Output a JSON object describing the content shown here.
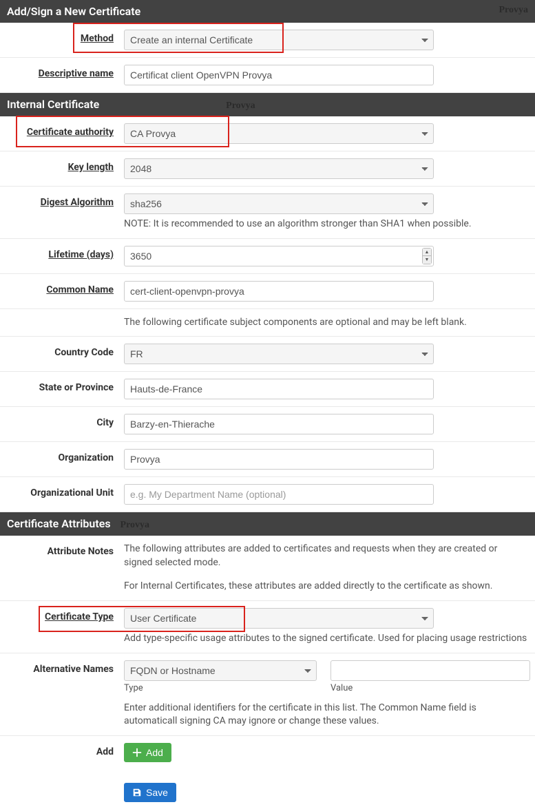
{
  "sections": {
    "add_sign": {
      "title": "Add/Sign a New Certificate",
      "watermark": "Provya"
    },
    "internal": {
      "title": "Internal Certificate",
      "watermark": "Provya"
    },
    "attributes": {
      "title": "Certificate Attributes",
      "watermark": "Provya"
    }
  },
  "fields": {
    "method": {
      "label": "Method",
      "value": "Create an internal Certificate"
    },
    "descriptive_name": {
      "label": "Descriptive name",
      "value": "Certificat client OpenVPN Provya"
    },
    "ca": {
      "label": "Certificate authority",
      "value": "CA Provya"
    },
    "key_length": {
      "label": "Key length",
      "value": "2048"
    },
    "digest": {
      "label": "Digest Algorithm",
      "value": "sha256",
      "note": "NOTE: It is recommended to use an algorithm stronger than SHA1 when possible."
    },
    "lifetime": {
      "label": "Lifetime (days)",
      "value": "3650"
    },
    "common_name": {
      "label": "Common Name",
      "value": "cert-client-openvpn-provya"
    },
    "subject_note": "The following certificate subject components are optional and may be left blank.",
    "country": {
      "label": "Country Code",
      "value": "FR"
    },
    "state": {
      "label": "State or Province",
      "value": "Hauts-de-France"
    },
    "city": {
      "label": "City",
      "value": "Barzy-en-Thierache"
    },
    "org": {
      "label": "Organization",
      "value": "Provya"
    },
    "ou": {
      "label": "Organizational Unit",
      "value": "",
      "placeholder": "e.g. My Department Name (optional)"
    },
    "attr_notes": {
      "label": "Attribute Notes",
      "text1": "The following attributes are added to certificates and requests when they are created or signed selected mode.",
      "text2": "For Internal Certificates, these attributes are added directly to the certificate as shown."
    },
    "cert_type": {
      "label": "Certificate Type",
      "value": "User Certificate",
      "note": "Add type-specific usage attributes to the signed certificate. Used for placing usage restrictions"
    },
    "alt_names": {
      "label": "Alternative Names",
      "type_value": "FQDN or Hostname",
      "type_label": "Type",
      "value_value": "",
      "value_label": "Value",
      "note": "Enter additional identifiers for the certificate in this list. The Common Name field is automaticall signing CA may ignore or change these values."
    },
    "add": {
      "label": "Add",
      "button": "Add"
    },
    "save": {
      "button": "Save"
    }
  }
}
